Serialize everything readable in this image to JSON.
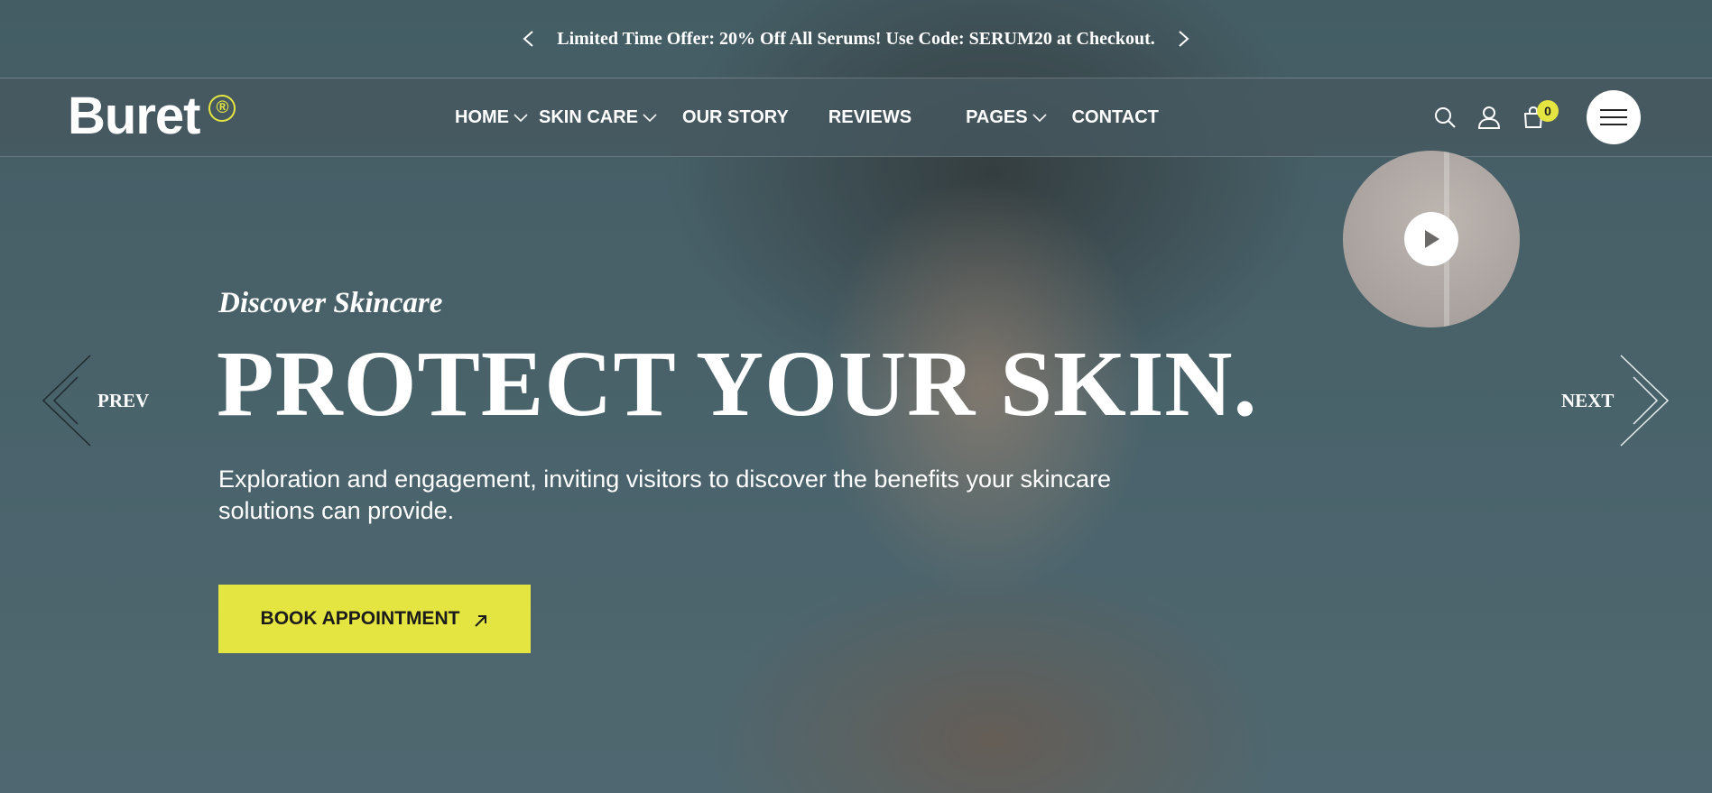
{
  "promo": {
    "text": "Limited Time Offer: 20% Off All Serums! Use Code: SERUM20 at Checkout."
  },
  "brand": {
    "name": "Buret",
    "mark": "®",
    "accent_color": "#e5e542"
  },
  "nav": {
    "items": [
      {
        "label": "HOME",
        "dropdown": true
      },
      {
        "label": "SKIN CARE",
        "dropdown": true
      },
      {
        "label": "OUR STORY",
        "dropdown": false
      },
      {
        "label": "REVIEWS",
        "dropdown": false
      },
      {
        "label": "PAGES",
        "dropdown": true
      },
      {
        "label": "CONTACT",
        "dropdown": false
      }
    ]
  },
  "header_icons": {
    "search": "search-icon",
    "account": "user-icon",
    "cart": "cart-icon",
    "cart_count": "0",
    "menu": "hamburger-menu-icon"
  },
  "hero": {
    "eyebrow": "Discover Skincare",
    "headline": "PROTECT YOUR SKIN.",
    "description": "Exploration and engagement, inviting visitors to discover the benefits your skincare solutions can provide.",
    "cta_label": "BOOK APPOINTMENT"
  },
  "slider": {
    "prev_label": "PREV",
    "next_label": "NEXT"
  }
}
